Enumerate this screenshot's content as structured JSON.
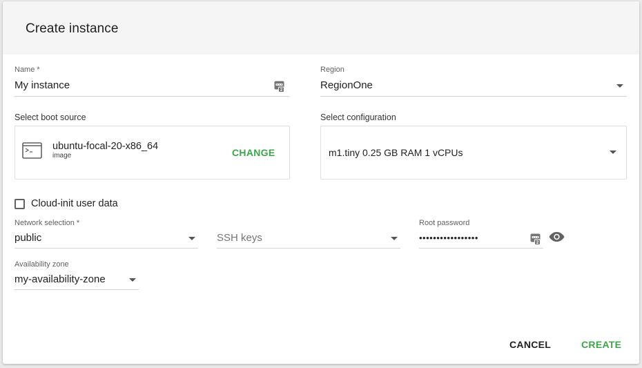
{
  "dialog": {
    "title": "Create instance"
  },
  "name_field": {
    "label": "Name *",
    "value": "My instance",
    "icon": "password-manager-icon"
  },
  "region_field": {
    "label": "Region",
    "value": "RegionOne"
  },
  "boot_source": {
    "label": "Select boot source",
    "image_name": "ubuntu-focal-20-x86_64",
    "image_type": "image",
    "change_label": "CHANGE",
    "icon": "terminal-icon"
  },
  "configuration": {
    "label": "Select configuration",
    "value": "m1.tiny 0.25 GB RAM 1 vCPUs"
  },
  "cloud_init": {
    "label": "Cloud-init user data",
    "checked": false
  },
  "network": {
    "label": "Network selection *",
    "value": "public"
  },
  "ssh_keys": {
    "placeholder": "SSH keys"
  },
  "root_password": {
    "label": "Root password",
    "value": "•••••••••••••••••",
    "icons": [
      "password-manager-icon",
      "eye-icon"
    ]
  },
  "availability_zone": {
    "label": "Availability zone",
    "value": "my-availability-zone"
  },
  "actions": {
    "cancel_label": "CANCEL",
    "create_label": "CREATE"
  },
  "colors": {
    "accent_green": "#3aa64a",
    "header_bg": "#f5f5f5",
    "text": "#212121"
  }
}
